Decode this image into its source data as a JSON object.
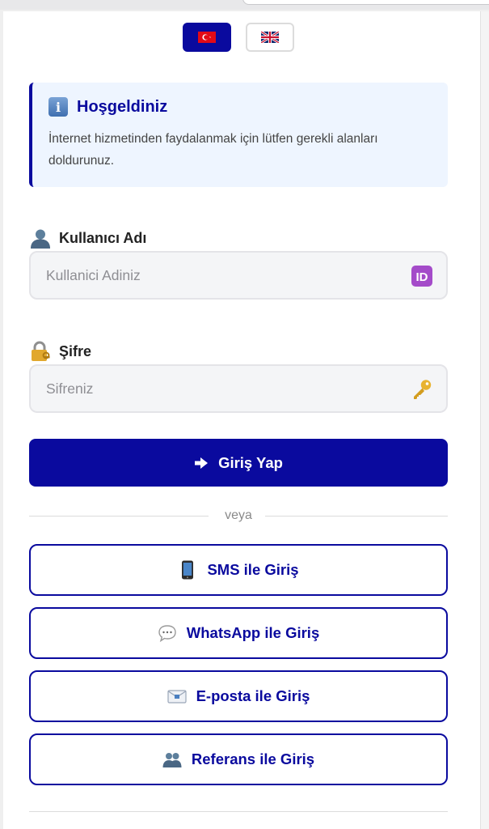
{
  "languages": [
    {
      "code": "tr",
      "flag": "turkey-flag-icon",
      "active": true
    },
    {
      "code": "en",
      "flag": "uk-flag-icon",
      "active": false
    }
  ],
  "info": {
    "icon": "info-icon",
    "icon_glyph": "i",
    "title": "Hoşgeldiniz",
    "text": "İnternet hizmetinden faydalanmak için lütfen gerekli alanları doldurunuz."
  },
  "username": {
    "label": "Kullanıcı Adı",
    "label_icon": "user-icon",
    "placeholder": "Kullanici Adiniz",
    "value": "",
    "input_icon": "id-icon",
    "input_icon_text": "ID"
  },
  "password": {
    "label": "Şifre",
    "label_icon": "lock-icon",
    "placeholder": "Sifreniz",
    "value": "",
    "input_icon": "key-icon"
  },
  "login_button": {
    "label": "Giriş Yap",
    "icon": "arrow-right-icon"
  },
  "divider_text": "veya",
  "alt_logins": [
    {
      "label": "SMS ile Giriş",
      "icon": "mobile-phone-icon"
    },
    {
      "label": "WhatsApp ile Giriş",
      "icon": "speech-bubble-icon"
    },
    {
      "label": "E-posta ile Giriş",
      "icon": "email-icon"
    },
    {
      "label": "Referans ile Giriş",
      "icon": "users-icon"
    }
  ],
  "colors": {
    "primary": "#0a0a9e",
    "info_bg": "#eef5ff",
    "input_bg": "#f4f5f7",
    "turkey_red": "#e30a17",
    "placeholder": "#8e8e93"
  }
}
